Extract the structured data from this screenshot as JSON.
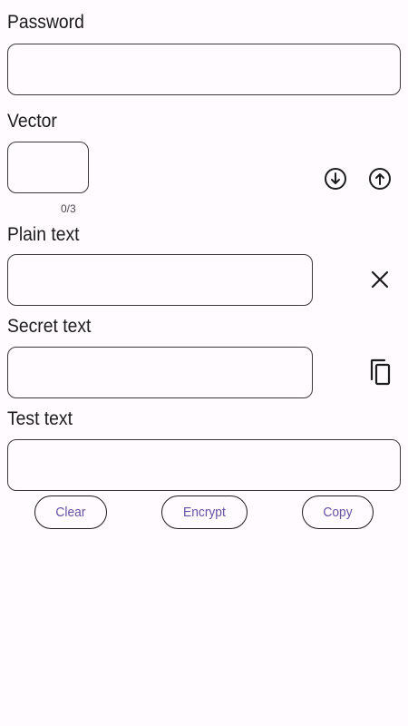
{
  "password": {
    "label": "Password",
    "value": ""
  },
  "vector": {
    "label": "Vector",
    "value": "",
    "counter": "0/3"
  },
  "plain_text": {
    "label": "Plain text",
    "value": ""
  },
  "secret_text": {
    "label": "Secret text",
    "value": ""
  },
  "test_text": {
    "label": "Test text",
    "value": ""
  },
  "icons": {
    "download": "arrow-down-circle-icon",
    "upload": "arrow-up-circle-icon",
    "clear": "close-icon",
    "copy": "copy-icon"
  },
  "buttons": {
    "clear_label": "Clear",
    "encrypt_label": "Encrypt",
    "copy_label": "Copy"
  },
  "colors": {
    "background": "#fffbfe",
    "accent": "#6750a4",
    "text": "#1c1b1f"
  }
}
